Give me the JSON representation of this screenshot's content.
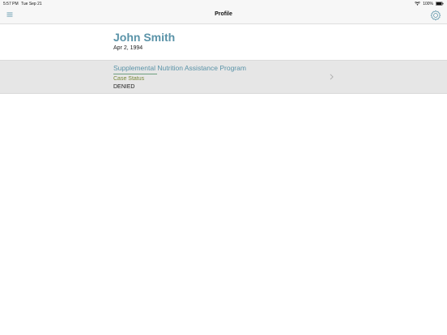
{
  "status_bar": {
    "time": "5:57 PM",
    "date": "Tue Sep 21",
    "battery": "100%"
  },
  "nav": {
    "title": "Profile",
    "left_icon": "menu-icon",
    "right_icon": "settings-icon"
  },
  "profile": {
    "name": "John Smith",
    "dob": "Apr 2, 1994"
  },
  "programs": [
    {
      "title": "Supplemental Nutrition Assistance Program",
      "status_label": "Case Status",
      "status_value": "DENIED"
    }
  ],
  "colors": {
    "accent": "#5a93a8",
    "status_label": "#7a8a3a",
    "row_background": "#e6e6e6",
    "bar_background": "#f7f7f7"
  }
}
